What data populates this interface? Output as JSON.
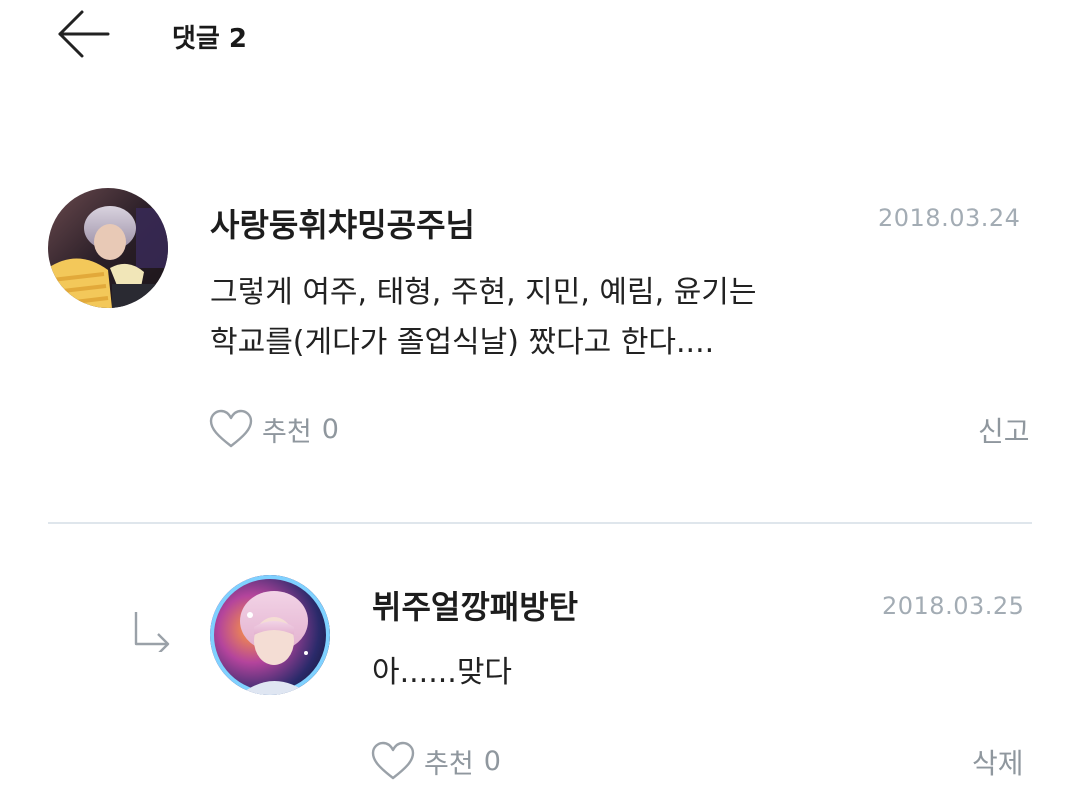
{
  "header": {
    "back_icon": "arrow-left-icon",
    "title": "댓글 2"
  },
  "comments": [
    {
      "author": "사랑둥휘챠밍공주님",
      "date": "2018.03.24",
      "body_lines": [
        "그렇게 여주, 태형, 주현, 지민, 예림, 윤기는",
        "학교를(게다가 졸업식날) 짰다고 한다...."
      ],
      "like_label": "추천",
      "like_count": "0",
      "action_label": "신고",
      "is_reply": false
    },
    {
      "author": "뷔주얼깡패방탄",
      "date": "2018.03.25",
      "body_lines": [
        "아......맞다"
      ],
      "like_label": "추천",
      "like_count": "0",
      "action_label": "삭제",
      "is_reply": true
    }
  ],
  "icons": {
    "like": "heart-outline-icon",
    "reply": "reply-arrow-icon"
  },
  "colors": {
    "meta_gray": "#8f979e",
    "date_gray": "#a3acb4",
    "divider": "#dfe6ec",
    "text": "#222222"
  }
}
